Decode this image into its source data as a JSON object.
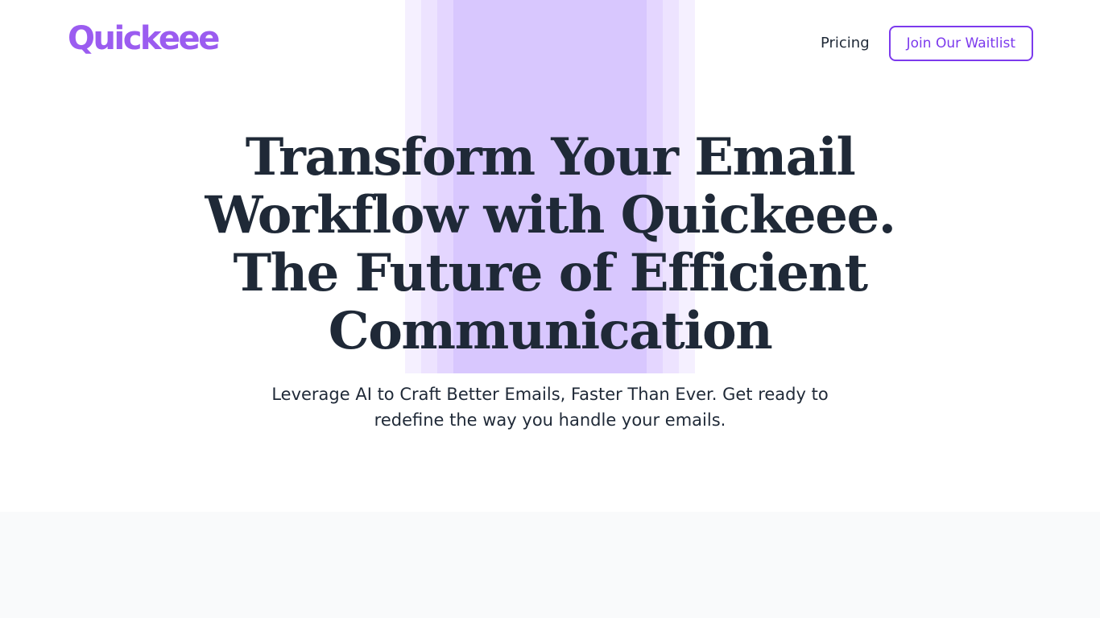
{
  "brand": {
    "name": "Quickeee",
    "color": "#9b5cf0"
  },
  "nav": {
    "pricing_label": "Pricing",
    "cta_label": "Join Our Waitlist",
    "cta_color": "#7c3aed"
  },
  "hero": {
    "headline_lines": [
      "Transform Your Email",
      "Workflow with Quickeee.",
      "The Future of Efficient",
      "Communication"
    ],
    "subtitle": "Leverage AI to Craft Better Emails, Faster Than Ever. Get ready to redefine the way you handle your emails."
  },
  "colors": {
    "text": "#1f2937",
    "stripe_light": "#f5f0ff",
    "stripe_dark": "#d8c7fe",
    "bottom_band": "#f9fafb"
  }
}
